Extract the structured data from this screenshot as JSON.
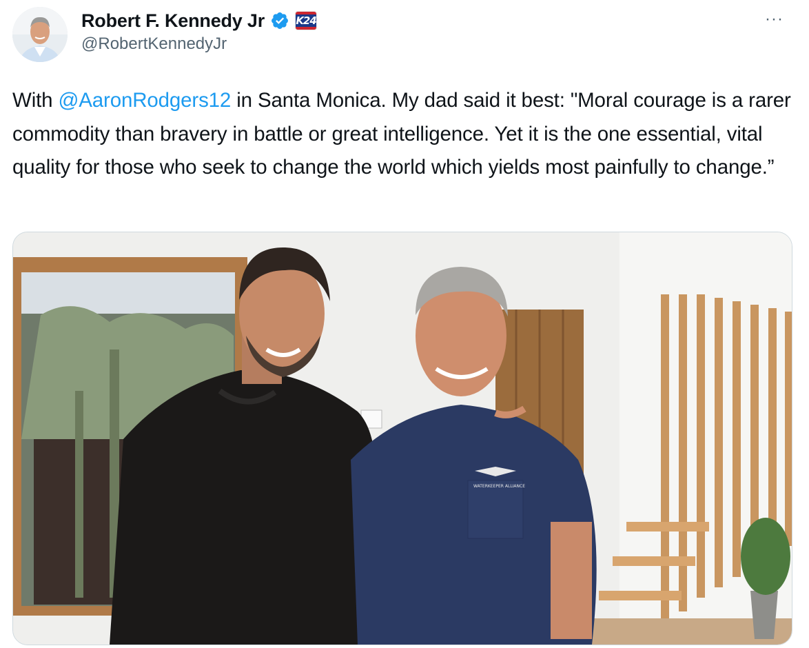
{
  "author": {
    "display_name": "Robert F. Kennedy Jr",
    "handle": "@RobertKennedyJr",
    "verified_icon": "verified-badge-icon",
    "affiliation_icon": "campaign-logo-icon",
    "affiliation_label": "K24"
  },
  "more_menu": {
    "label": "···",
    "icon": "more-horizontal-icon"
  },
  "tweet": {
    "text_before": "With ",
    "mention": "@AaronRodgers12",
    "text_after": " in Santa Monica. My dad said it best: \"Moral courage is a rarer commodity than bravery in battle or great intelligence. Yet it is the one essential, vital quality for those who seek to change the world which yields most painfully to change.”"
  },
  "media": {
    "shirt_logo_text": "WATERKEEPER ALLIANCE"
  },
  "colors": {
    "accent": "#1d9bf0",
    "text": "#0f1419",
    "secondary_text": "#536471",
    "border": "#cfd9de"
  }
}
